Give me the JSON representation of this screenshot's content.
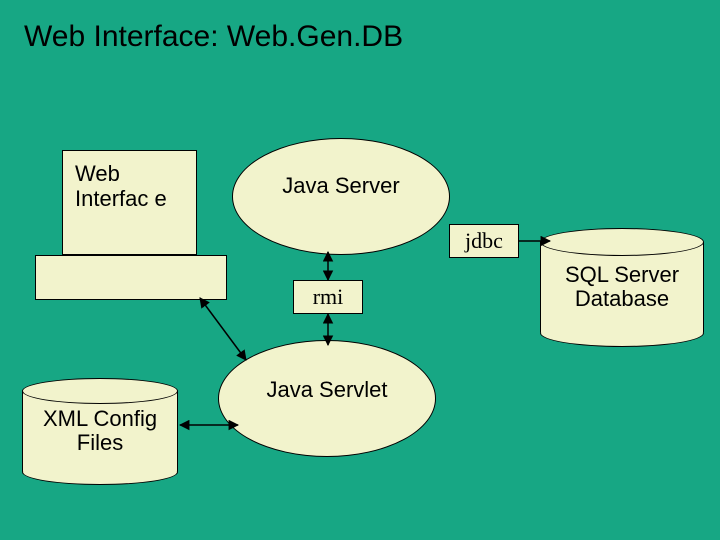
{
  "title": "Web Interface: Web.Gen.DB",
  "nodes": {
    "web_interface": "Web Interfac e",
    "java_server": "Java Server",
    "java_servlet": "Java Servlet",
    "sql_db": "SQL Server Database",
    "xml_config": "XML Config Files"
  },
  "edges": {
    "rmi": "rmi",
    "jdbc": "jdbc"
  },
  "colors": {
    "bg": "#17a784",
    "node_fill": "#f2f3cc",
    "stroke": "#000000"
  }
}
